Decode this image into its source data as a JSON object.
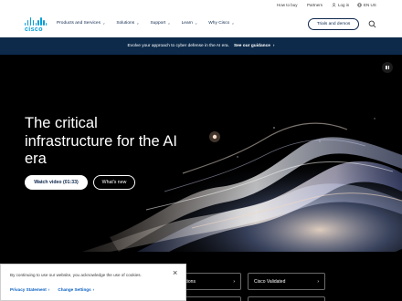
{
  "utility": {
    "how_to_buy": "How to buy",
    "partners": "Partners",
    "login": "Log in",
    "language": "EN US"
  },
  "header": {
    "logo_text": "cisco",
    "nav": [
      {
        "label": "Products and Services"
      },
      {
        "label": "Solutions"
      },
      {
        "label": "Support"
      },
      {
        "label": "Learn"
      },
      {
        "label": "Why Cisco"
      }
    ],
    "trials_label": "Trials and demos"
  },
  "banner": {
    "text": "Evolve your approach to cyber defense in the AI era.",
    "link": "See our guidance"
  },
  "hero": {
    "title": "The critical infrastructure for the AI era",
    "watch_label": "Watch video (01:33)",
    "whats_new_label": "What's new"
  },
  "cards": {
    "card1_label": "ications",
    "card2_label": "Cisco Validated"
  },
  "cookie": {
    "message": "By continuing to use our website, you acknowledge the use of cookies.",
    "privacy_label": "Privacy Statement",
    "settings_label": "Change Settings"
  },
  "colors": {
    "brand_blue": "#049fd9",
    "navy": "#0d274d",
    "banner_bg": "#0d2a4a",
    "link_blue": "#0a60c2"
  }
}
